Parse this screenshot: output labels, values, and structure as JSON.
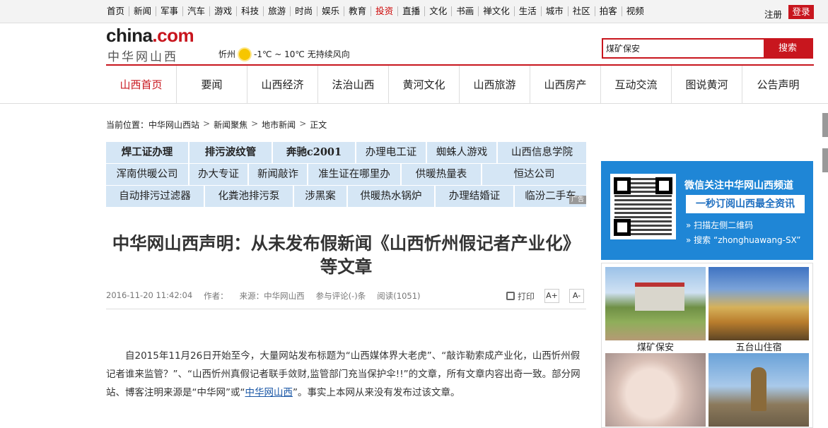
{
  "topnav": {
    "items": [
      "首页",
      "新闻",
      "军事",
      "汽车",
      "游戏",
      "科技",
      "旅游",
      "时尚",
      "娱乐",
      "教育",
      "投资",
      "直播",
      "文化",
      "书画",
      "禅文化",
      "生活",
      "城市",
      "社区",
      "拍客",
      "视频"
    ],
    "highlight_index": 10,
    "register": "注册",
    "login": "登录"
  },
  "header": {
    "logo_en_main": "china",
    "logo_en_dot": ".",
    "logo_en_com": "com",
    "logo_cn": "中华网山西",
    "weather_city": "忻州",
    "weather_text": "-1℃ ~ 10℃ 无持续风向",
    "search_value": "煤矿保安",
    "search_button": "搜索"
  },
  "mainnav": {
    "items": [
      "山西首页",
      "要闻",
      "山西经济",
      "法治山西",
      "黄河文化",
      "山西旅游",
      "山西房产",
      "互动交流",
      "图说黄河",
      "公告声明"
    ],
    "active_index": 0
  },
  "breadcrumb": {
    "label": "当前位置：",
    "items": [
      "中华网山西站",
      "新闻聚焦",
      "地市新闻",
      "正文"
    ]
  },
  "ads": {
    "rows": [
      [
        "焊工证办理",
        "排污波纹管",
        "奔驰c2001",
        "办理电工证",
        "蜘蛛人游戏",
        "山西信息学院"
      ],
      [
        "浑南供暖公司",
        "办大专证",
        "新闻敲诈",
        "准生证在哪里办",
        "供暖热量表",
        "恒达公司"
      ],
      [
        "自动排污过滤器",
        "化粪池排污泵",
        "涉黑案",
        "供暖热水锅炉",
        "办理结婚证",
        "临汾二手车"
      ]
    ],
    "tag": "广告"
  },
  "article": {
    "title": "中华网山西声明：从未发布假新闻《山西忻州假记者产业化》等文章",
    "date": "2016-11-20 11:42:04",
    "author": "作者：",
    "source": "来源：中华网山西",
    "comments": "参与评论(-)条",
    "reads": "阅读(1051)",
    "print": "打印",
    "font_up": "A+",
    "font_down": "A-",
    "para1_a": "自2015年11月26日开始至今，大量网站发布标题为“山西媒体界大老虎”、“敲诈勒索成产业化，山西忻州假记者谁来监管？”、“山西忻州真假记者联手敛财,监管部门充当保护伞!!”的文章，所有文章内容出奇一致。部分网站、博客注明来源是“中华网”或“",
    "para1_link": "中华网山西",
    "para1_b": "”。事实上本网从来没有发布过该文章。"
  },
  "sidebar": {
    "wx_line1": "微信关注中华网山西频道",
    "wx_line2": "一秒订阅山西最全资讯",
    "wx_line3": "» 扫描左侧二维码",
    "wx_line4": "» 搜索 “zhonghuawang-SX”",
    "photo1_caption": "煤矿保安",
    "photo2_caption": "五台山住宿"
  }
}
